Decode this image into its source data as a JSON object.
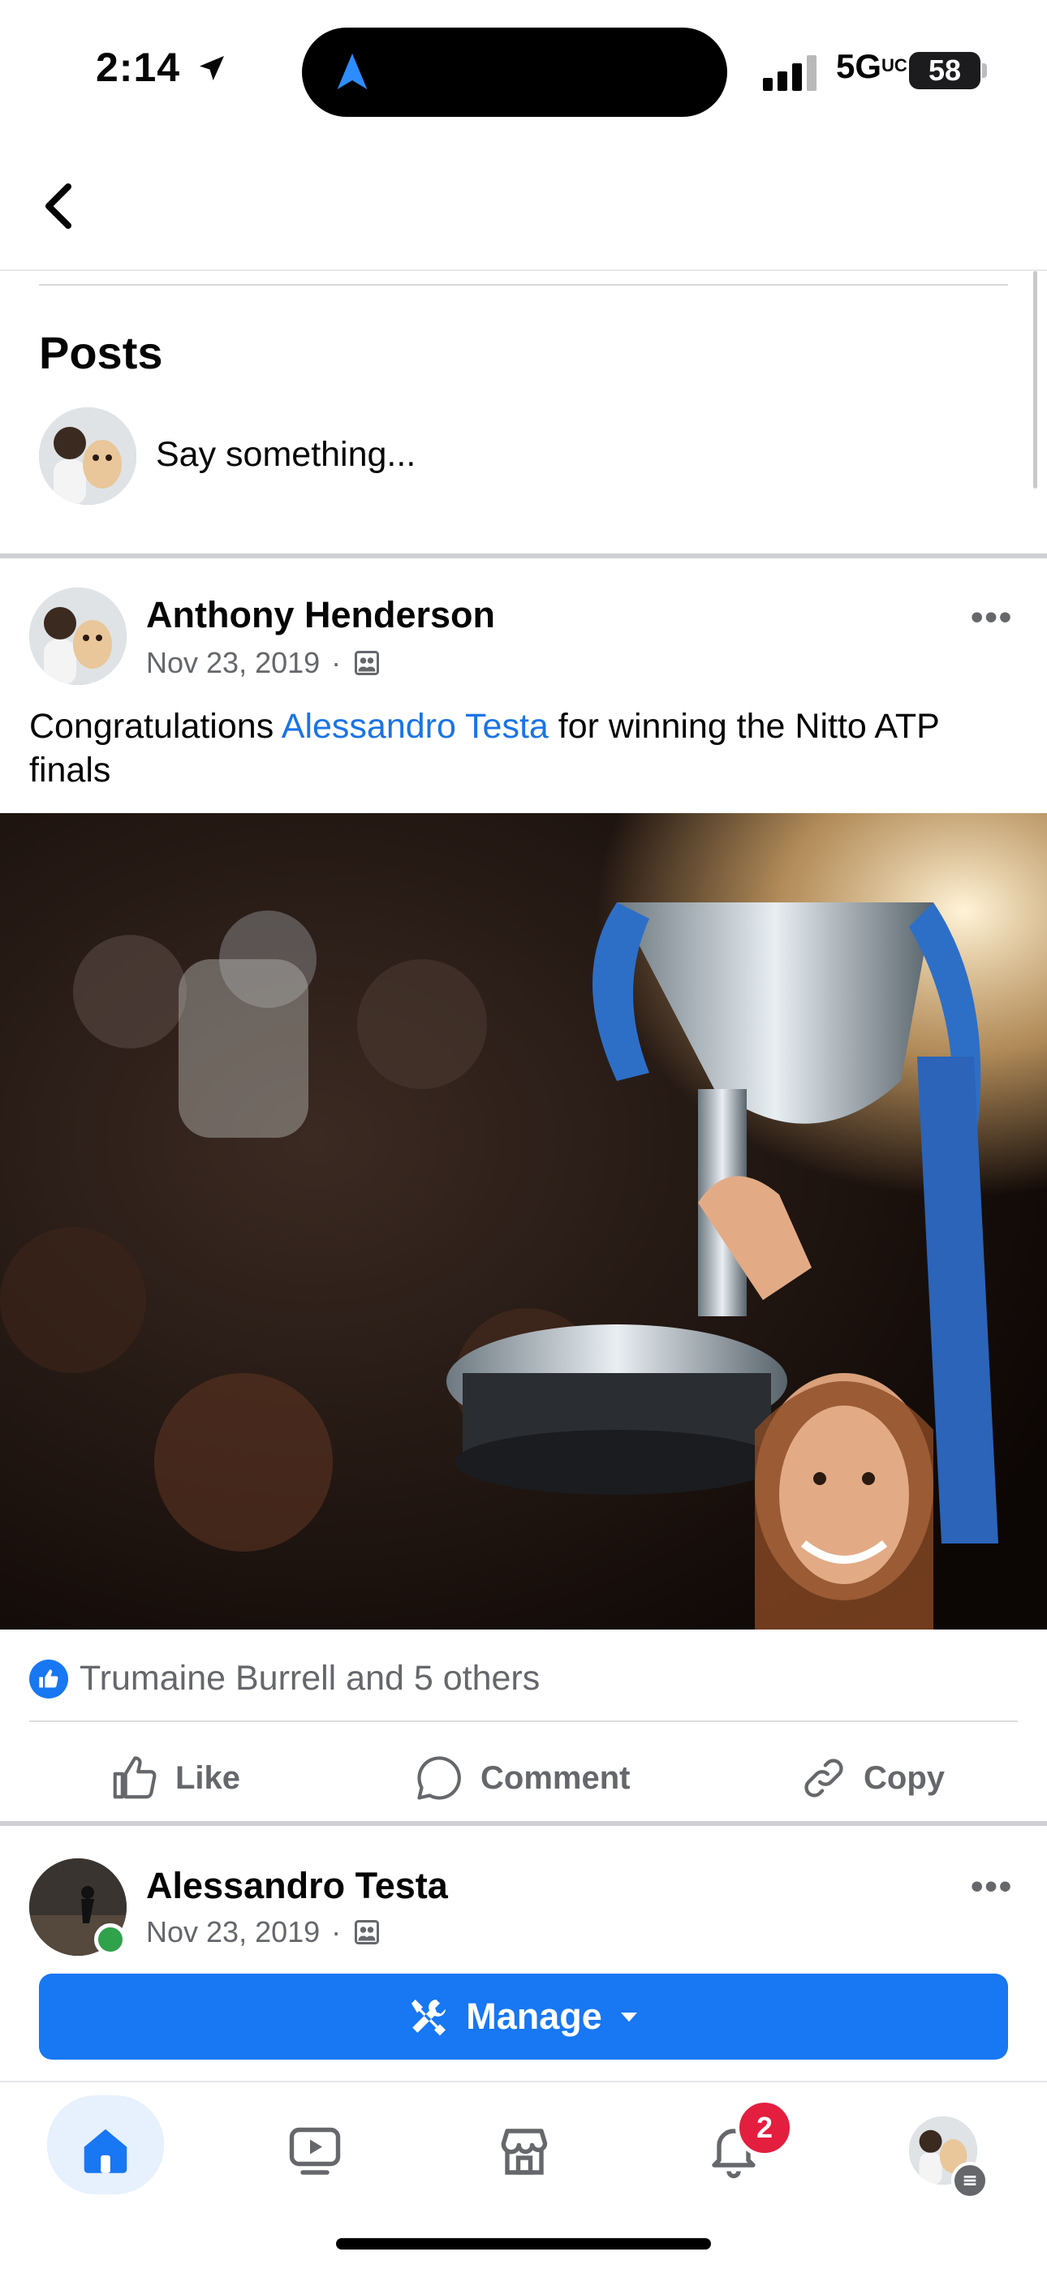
{
  "status_bar": {
    "time": "2:14",
    "network": "5G",
    "network_sub": "UC",
    "battery": "58"
  },
  "section": {
    "title": "Posts",
    "composer_placeholder": "Say something..."
  },
  "posts": [
    {
      "author": "Anthony Henderson",
      "date": "Nov 23, 2019",
      "text_before": "Congratulations ",
      "mention": "Alessandro Testa",
      "text_after": " for winning the Nitto ATP finals",
      "image_alt": "Player raising Nitto ATP Finals trophy",
      "reactions_text": "Trumaine Burrell and 5 others",
      "actions": {
        "like": "Like",
        "comment": "Comment",
        "copy": "Copy"
      }
    },
    {
      "author": "Alessandro Testa",
      "date": "Nov 23, 2019"
    }
  ],
  "manage_button": {
    "label": "Manage"
  },
  "tabbar": {
    "notifications_count": "2"
  },
  "colors": {
    "accent": "#1877f2",
    "mention": "#1b74e4",
    "badge": "#e41e3f",
    "secondary_text": "#65676b"
  }
}
